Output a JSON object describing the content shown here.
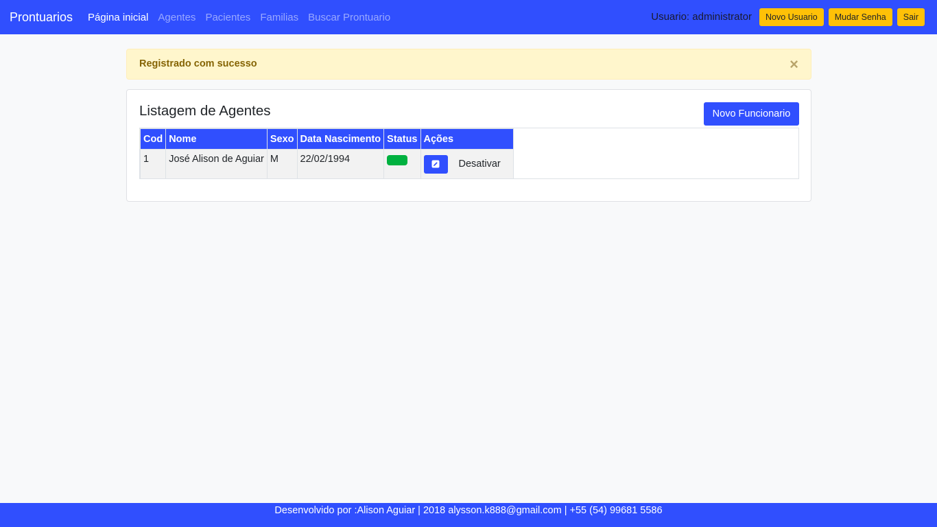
{
  "navbar": {
    "brand": "Prontuarios",
    "links": [
      {
        "label": "Página inicial",
        "active": true
      },
      {
        "label": "Agentes",
        "active": false
      },
      {
        "label": "Pacientes",
        "active": false
      },
      {
        "label": "Familias",
        "active": false
      },
      {
        "label": "Buscar Prontuario",
        "active": false
      }
    ],
    "user_label": "Usuario: administrator",
    "buttons": {
      "new_user": "Novo Usuario",
      "change_password": "Mudar Senha",
      "logout": "Sair"
    }
  },
  "alert": {
    "message": "Registrado com sucesso",
    "close": "×"
  },
  "card": {
    "title": "Listagem de Agentes",
    "new_button": "Novo Funcionario"
  },
  "table": {
    "headers": [
      "Cod",
      "Nome",
      "Sexo",
      "Data Nascimento",
      "Status",
      "Ações"
    ],
    "rows": [
      {
        "cod": "1",
        "nome": "José Alison de Aguiar",
        "sexo": "M",
        "data_nascimento": "22/02/1994",
        "status_color": "#00b140",
        "action_label": "Desativar"
      }
    ]
  },
  "footer": {
    "text": "Desenvolvido por :Alison Aguiar | 2018 alysson.k888@gmail.com | +55 (54) 99681 5586"
  },
  "colors": {
    "primary": "#304ffe",
    "warning": "#ffc107",
    "success": "#00b140"
  },
  "icons": {
    "edit": "pencil-square-icon"
  }
}
